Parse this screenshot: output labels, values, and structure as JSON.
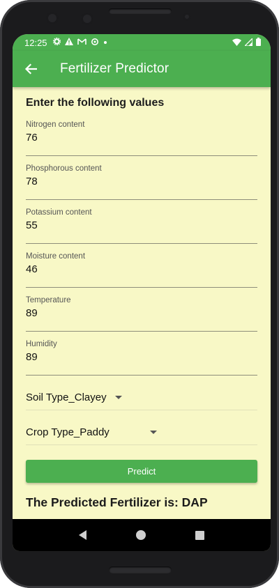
{
  "status": {
    "time": "12:25",
    "icons": [
      "gear-icon",
      "warning-icon",
      "gmail-icon",
      "settings-icon",
      "dot-icon"
    ],
    "right_icons": [
      "wifi-icon",
      "signal-icon",
      "battery-icon"
    ]
  },
  "appbar": {
    "title": "Fertilizer Predictor"
  },
  "form": {
    "heading": "Enter the following values",
    "fields": [
      {
        "label": "Nitrogen content",
        "value": "76"
      },
      {
        "label": "Phosphorous content",
        "value": "78"
      },
      {
        "label": "Potassium content",
        "value": "55"
      },
      {
        "label": "Moisture content",
        "value": "46"
      },
      {
        "label": "Temperature",
        "value": "89"
      },
      {
        "label": "Humidity",
        "value": "89"
      }
    ],
    "soil_type": "Soil Type_Clayey",
    "crop_type": "Crop Type_Paddy",
    "predict_label": "Predict",
    "result": "The Predicted Fertilizer is: DAP"
  },
  "colors": {
    "accent": "#4caf50",
    "background": "#f8f8c6"
  }
}
